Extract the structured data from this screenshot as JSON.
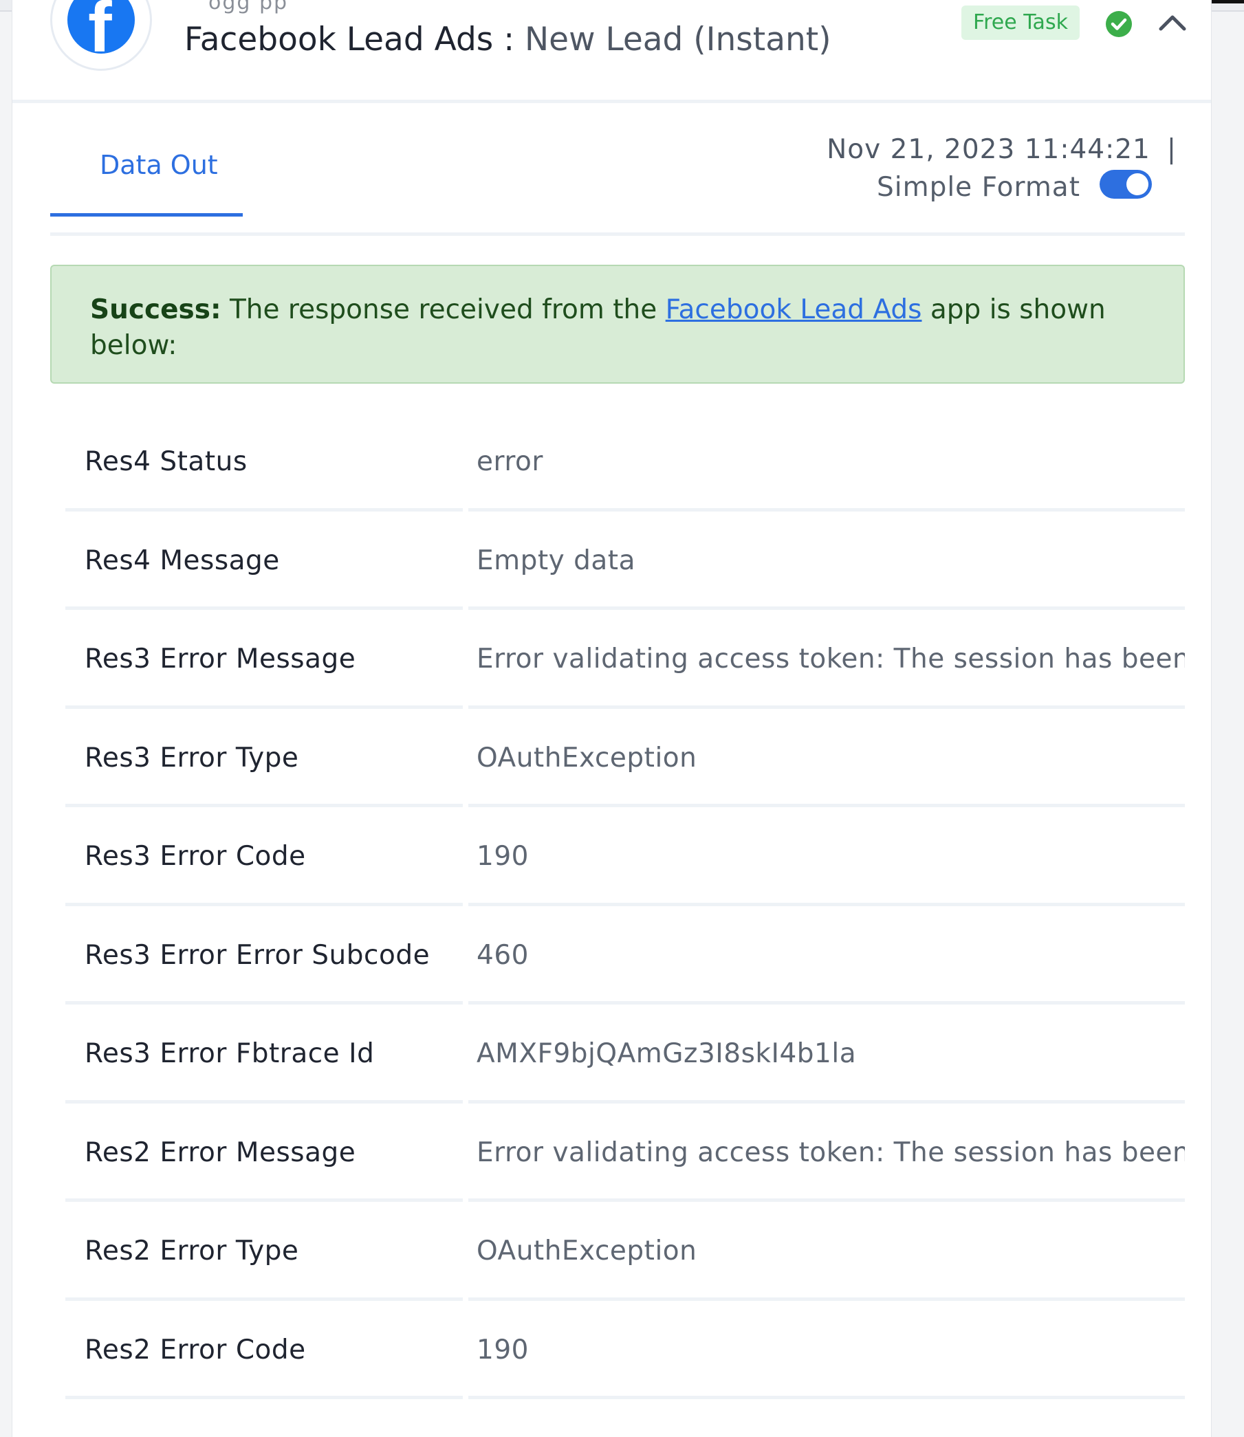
{
  "header": {
    "app_name": "Facebook Lead Ads",
    "separator": " : ",
    "event": "New Lead (Instant)",
    "faint_text": "ogg              pp",
    "badge": "Free Task"
  },
  "tabs": {
    "data_out": "Data Out"
  },
  "meta": {
    "timestamp": "Nov 21, 2023 11:44:21",
    "divider": "|",
    "format_label": "Simple Format",
    "format_enabled": true
  },
  "alert": {
    "prefix": "Success:",
    "text_before": " The response received from the ",
    "link": "Facebook Lead Ads",
    "text_after": " app is shown below:"
  },
  "rows": [
    {
      "key": "Res4 Status",
      "value": "error"
    },
    {
      "key": "Res4 Message",
      "value": "Empty data"
    },
    {
      "key": "Res3 Error Message",
      "value": "Error validating access token: The session has been inva"
    },
    {
      "key": "Res3 Error Type",
      "value": "OAuthException"
    },
    {
      "key": "Res3 Error Code",
      "value": "190"
    },
    {
      "key": "Res3 Error Error Subcode",
      "value": "460"
    },
    {
      "key": "Res3 Error Fbtrace Id",
      "value": "AMXF9bjQAmGz3I8skI4b1la"
    },
    {
      "key": "Res2 Error Message",
      "value": "Error validating access token: The session has been inva"
    },
    {
      "key": "Res2 Error Type",
      "value": "OAuthException"
    },
    {
      "key": "Res2 Error Code",
      "value": "190"
    }
  ],
  "colors": {
    "accent": "#2d6fe0",
    "success_bg": "#d8ecd6",
    "badge_text": "#2fa84f",
    "facebook": "#1877f2"
  },
  "icons": {
    "logo": "facebook-logo-icon",
    "status": "check-circle-icon",
    "collapse": "chevron-up-icon"
  }
}
